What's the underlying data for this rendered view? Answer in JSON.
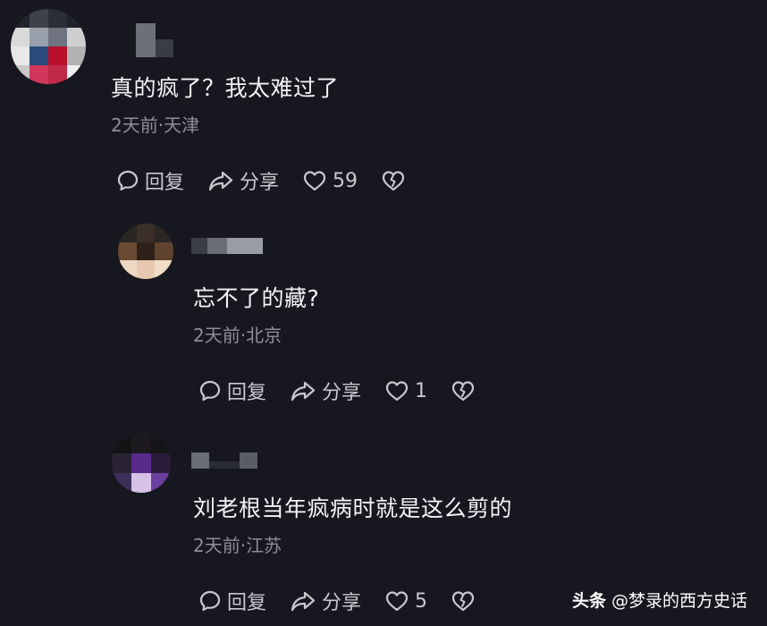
{
  "comments": [
    {
      "text": "真的疯了？我太难过了",
      "meta": "2天前·天津",
      "reply_label": "回复",
      "share_label": "分享",
      "like_count": "59"
    },
    {
      "text": "忘不了的藏?",
      "meta": "2天前·北京",
      "reply_label": "回复",
      "share_label": "分享",
      "like_count": "1"
    },
    {
      "text": "刘老根当年疯病时就是这么剪的",
      "meta": "2天前·江苏",
      "reply_label": "回复",
      "share_label": "分享",
      "like_count": "5"
    }
  ],
  "watermark": {
    "brand": "头条",
    "handle": "@梦录的西方史话"
  },
  "icons": {
    "reply": "comment-bubble-icon",
    "share": "share-arrow-icon",
    "like": "heart-icon",
    "dislike": "broken-heart-icon"
  },
  "colors": {
    "background": "#17181f",
    "text": "#f4f4f4",
    "meta": "#8e8f96",
    "action": "#c7c8cc"
  }
}
